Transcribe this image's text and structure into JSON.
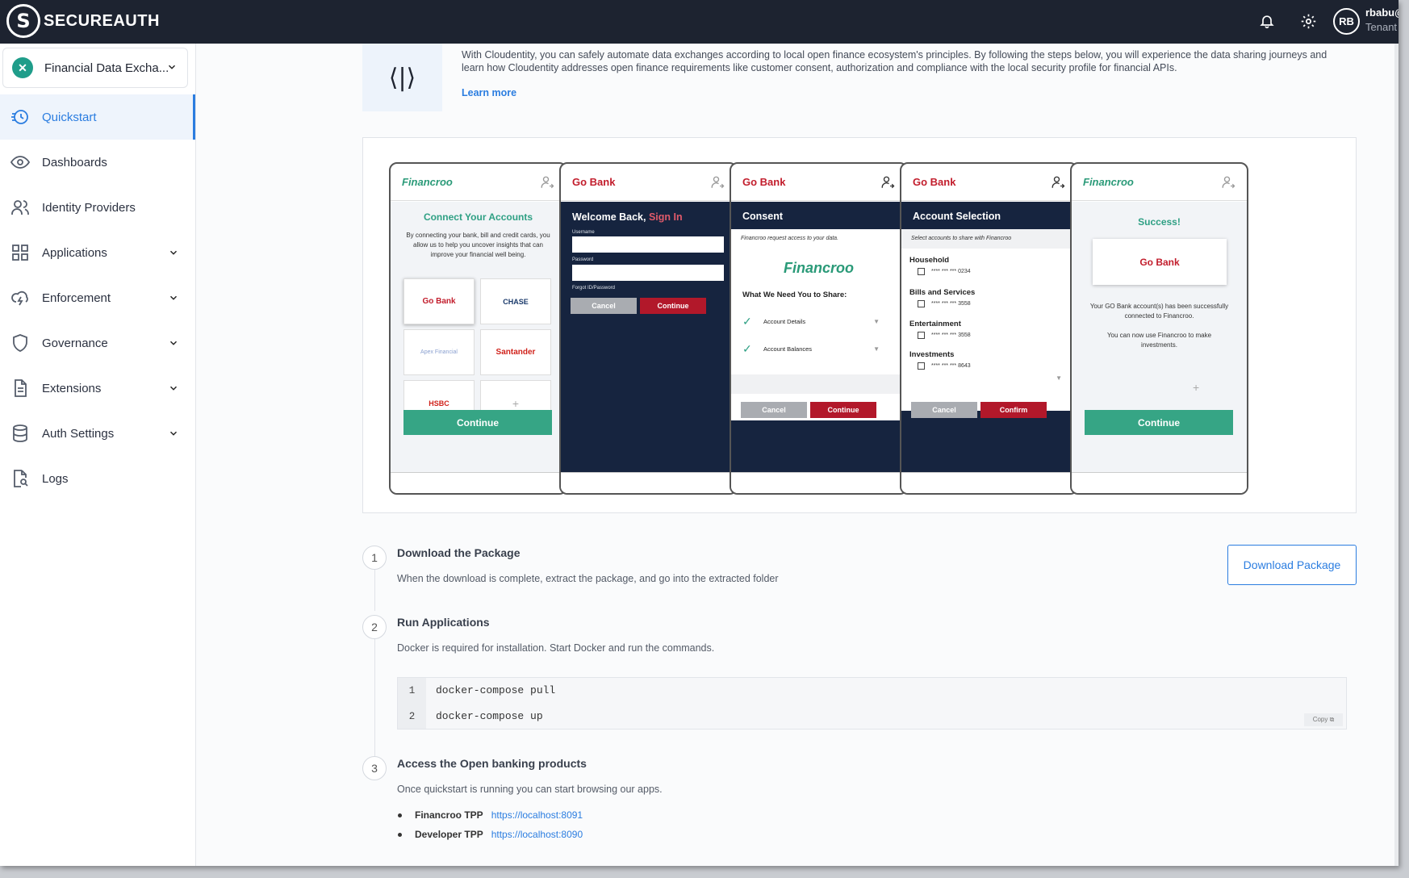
{
  "brand": {
    "name": "SECUREAUTH",
    "logo_letter": "S"
  },
  "header": {
    "user_initials": "RB",
    "user_name": "rbabu@",
    "user_role": "Tenant"
  },
  "sidebar": {
    "workspace": "Financial Data Excha...",
    "items": [
      {
        "label": "Quickstart",
        "active": true
      },
      {
        "label": "Dashboards"
      },
      {
        "label": "Identity Providers"
      },
      {
        "label": "Applications",
        "expandable": true
      },
      {
        "label": "Enforcement",
        "expandable": true
      },
      {
        "label": "Governance",
        "expandable": true
      },
      {
        "label": "Extensions",
        "expandable": true
      },
      {
        "label": "Auth Settings",
        "expandable": true
      },
      {
        "label": "Logs"
      }
    ]
  },
  "intro": {
    "icon_glyph": "⟨|⟩",
    "text": "With Cloudentity, you can safely automate data exchanges according to local open finance ecosystem's principles. By following the steps below, you will experience the data sharing journeys and learn how Cloudentity addresses open finance requirements like customer consent, authorization and compliance with the local security profile for financial APIs.",
    "learn_more": "Learn more"
  },
  "preview": {
    "financroo": "Financroo",
    "gobank": "Go Bank",
    "p1": {
      "title": "Connect Your Accounts",
      "text": "By connecting your bank, bill and credit cards, you allow us to help you uncover insights that can improve your financial well being.",
      "banks": [
        "Go Bank",
        "CHASE",
        "Apex Financial",
        "Santander",
        "HSBC",
        "+"
      ],
      "cta": "Continue"
    },
    "p2": {
      "title": "Welcome Back,",
      "title_accent": "Sign In",
      "username": "Username",
      "password": "Password",
      "forgot": "Forgot ID/Password",
      "cancel": "Cancel",
      "cta": "Continue"
    },
    "p3": {
      "title": "Consent",
      "note": "Financroo request access to your data.",
      "share_title": "What We Need You to Share:",
      "items": [
        "Account Details",
        "Account Balances"
      ],
      "cancel": "Cancel",
      "cta": "Continue"
    },
    "p4": {
      "title": "Account Selection",
      "note": "Select accounts to share with Financroo",
      "groups": [
        {
          "name": "Household",
          "acct": "**** *** *** 0234"
        },
        {
          "name": "Bills and Services",
          "acct": "**** *** *** 3558"
        },
        {
          "name": "Entertainment",
          "acct": "**** *** *** 3558"
        },
        {
          "name": "Investments",
          "acct": "**** *** *** 8643"
        }
      ],
      "cancel": "Cancel",
      "cta": "Confirm"
    },
    "p5": {
      "title": "Success!",
      "text1": "Your GO Bank account(s) has been successfully connected to Financroo.",
      "text2": "You can now use Financroo to make investments.",
      "plus": "+",
      "cta": "Continue"
    }
  },
  "steps": [
    {
      "num": "1",
      "title": "Download the Package",
      "desc": "When the download is complete, extract the package, and go into the extracted folder"
    },
    {
      "num": "2",
      "title": "Run Applications",
      "desc": "Docker is required for installation. Start Docker and run the commands."
    },
    {
      "num": "3",
      "title": "Access the Open banking products",
      "desc": "Once quickstart is running you can start browsing our apps."
    }
  ],
  "download_button": "Download Package",
  "code": {
    "lines": [
      {
        "n": "1",
        "text": "docker-compose pull"
      },
      {
        "n": "2",
        "text": "docker-compose up"
      }
    ],
    "copy": "Copy ⧉"
  },
  "tpp": [
    {
      "name": "Financroo TPP",
      "url": "https://localhost:8091"
    },
    {
      "name": "Developer TPP",
      "url": "https://localhost:8090"
    }
  ],
  "colors": {
    "accent": "#2b7de0",
    "topbar": "#1d2330",
    "financroo": "#2a9a78",
    "gobank": "#c21d2c"
  }
}
